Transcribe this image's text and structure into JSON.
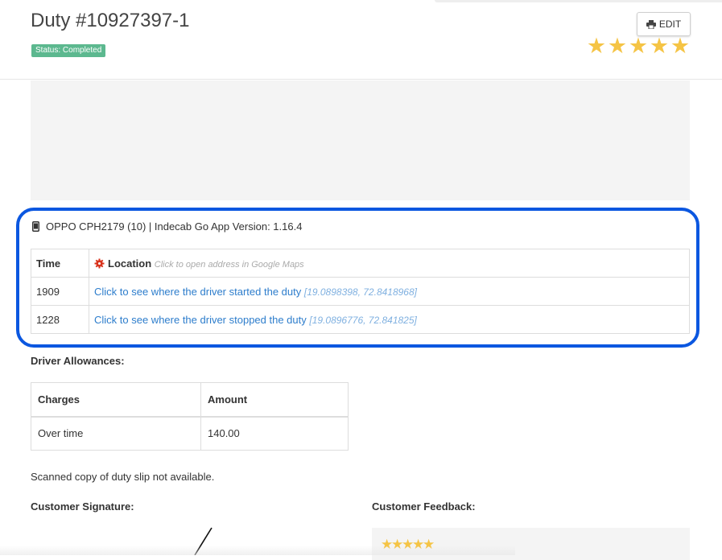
{
  "duty": {
    "title": "Duty #10927397-1",
    "status": "Status: Completed",
    "edit_label": "EDIT",
    "rating": 5
  },
  "device": {
    "info": "OPPO CPH2179 (10) | Indecab Go App Version: 1.16.4"
  },
  "locations": {
    "col_time": "Time",
    "col_location": "Location",
    "location_hint": "Click to open address in Google Maps",
    "rows": [
      {
        "time": "1909",
        "link": "Click to see where the driver started the duty",
        "coords": "[19.0898398, 72.8418968]"
      },
      {
        "time": "1228",
        "link": "Click to see where the driver stopped the duty",
        "coords": "[19.0896776, 72.841825]"
      }
    ]
  },
  "allowances": {
    "heading": "Driver Allowances:",
    "col_charges": "Charges",
    "col_amount": "Amount",
    "rows": [
      {
        "charge": "Over time",
        "amount": "140.00"
      }
    ]
  },
  "duty_slip": {
    "note": "Scanned copy of duty slip not available."
  },
  "signature": {
    "heading": "Customer Signature:"
  },
  "feedback": {
    "heading": "Customer Feedback:",
    "rating": 5
  },
  "colors": {
    "status_badge": "#5cb88f",
    "star": "#f5c445",
    "link": "#2d7dcc",
    "highlight": "#0b57e0"
  },
  "icons": [
    "print-icon",
    "star-icon",
    "phone-icon",
    "gear-icon"
  ]
}
